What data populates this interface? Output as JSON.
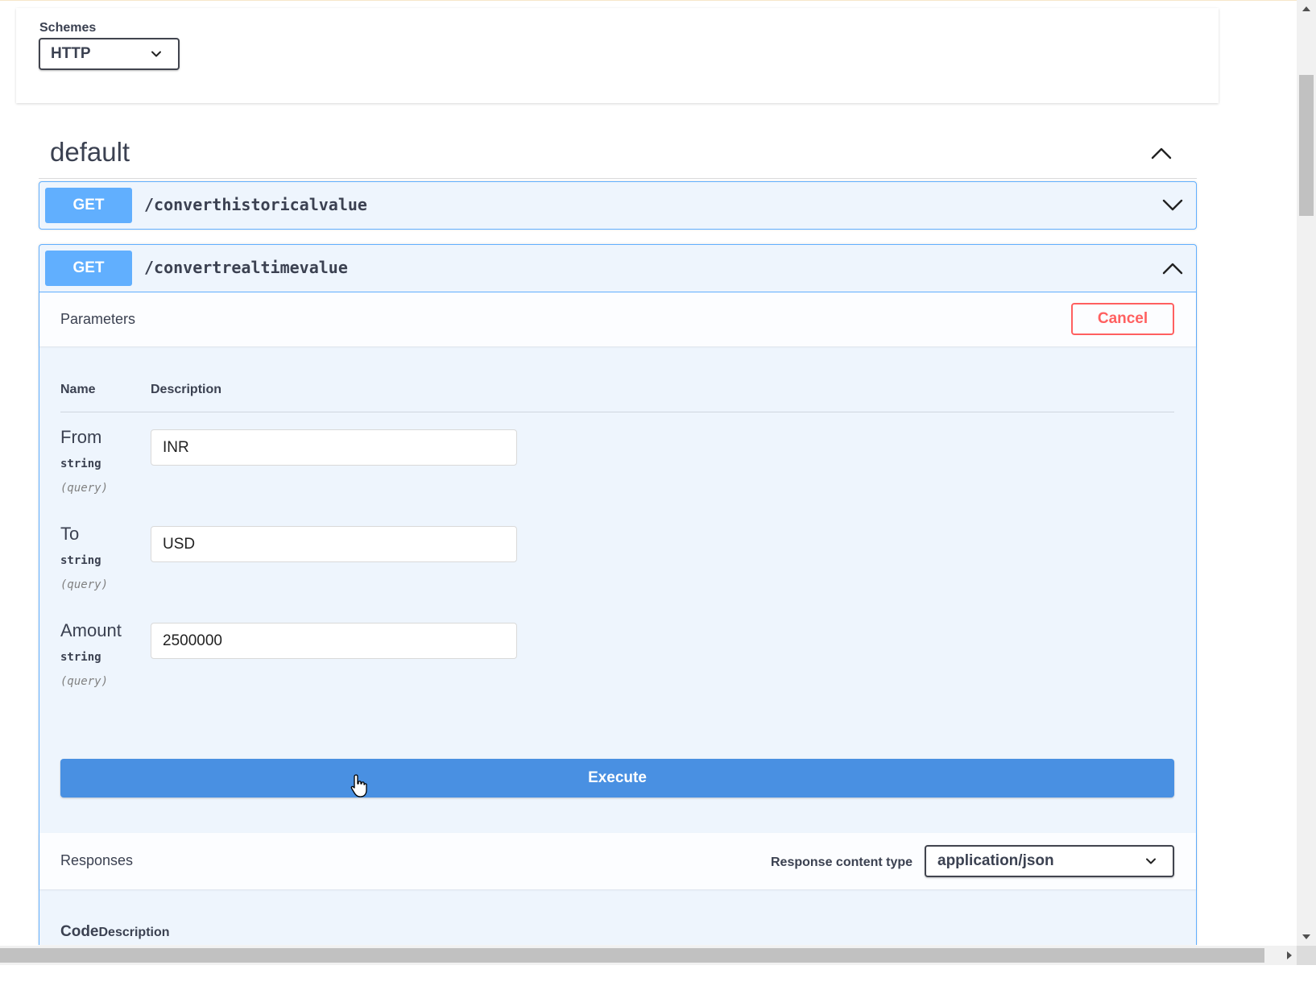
{
  "schemes": {
    "label": "Schemes",
    "selected": "HTTP"
  },
  "tag": {
    "title": "default"
  },
  "operations": [
    {
      "method": "GET",
      "path": "/converthistoricalvalue",
      "expanded": false
    },
    {
      "method": "GET",
      "path": "/convertrealtimevalue",
      "expanded": true
    }
  ],
  "parameters": {
    "title": "Parameters",
    "cancel_label": "Cancel",
    "columns": {
      "name": "Name",
      "description": "Description"
    },
    "items": [
      {
        "name": "From",
        "type": "string",
        "in": "(query)",
        "value": "INR"
      },
      {
        "name": "To",
        "type": "string",
        "in": "(query)",
        "value": "USD"
      },
      {
        "name": "Amount",
        "type": "string",
        "in": "(query)",
        "value": "2500000"
      }
    ]
  },
  "execute_label": "Execute",
  "responses": {
    "title": "Responses",
    "content_type_label": "Response content type",
    "content_type": "application/json",
    "columns": {
      "code": "Code",
      "description": "Description"
    }
  },
  "colors": {
    "get": "#61affe",
    "cancel": "#ff6060",
    "execute": "#4990e2",
    "text": "#3b4151"
  }
}
